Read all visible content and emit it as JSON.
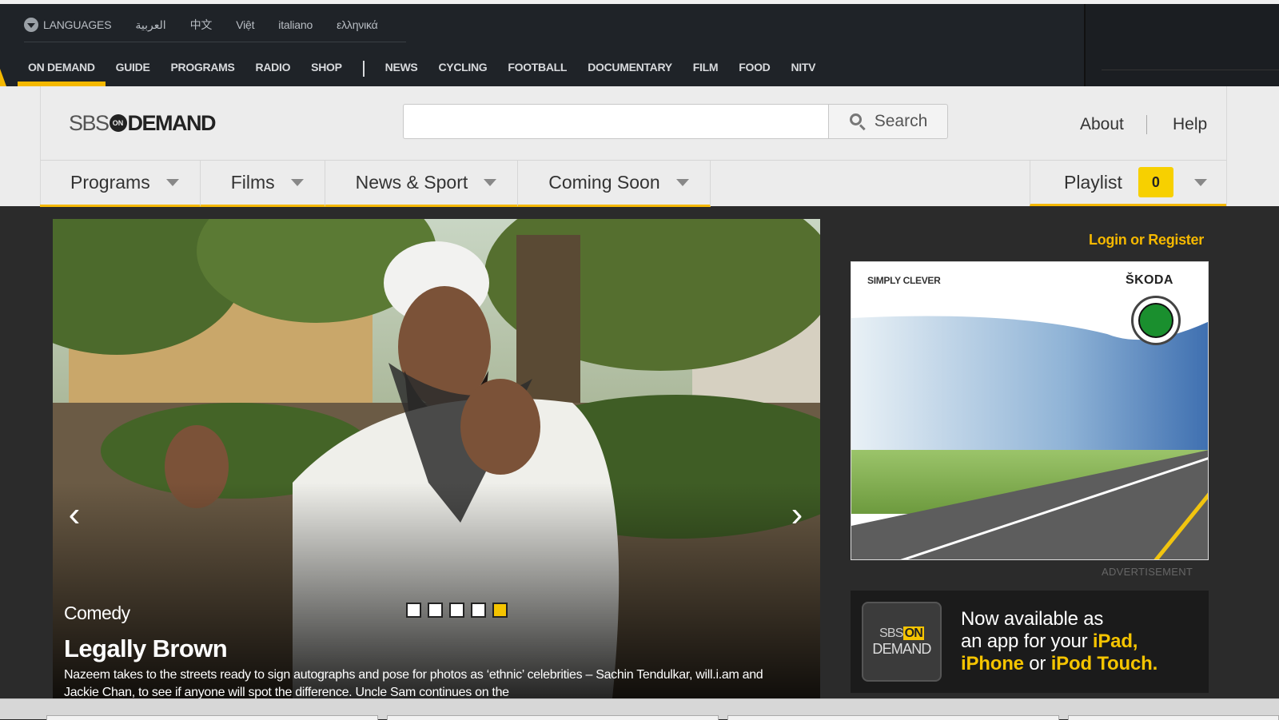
{
  "languages": {
    "label": "LANGUAGES",
    "items": [
      "العربية",
      "中文",
      "Việt",
      "italiano",
      "ελληνικά"
    ]
  },
  "main_nav": {
    "group1": [
      "ON DEMAND",
      "GUIDE",
      "PROGRAMS",
      "RADIO",
      "SHOP"
    ],
    "group2": [
      "NEWS",
      "CYCLING",
      "FOOTBALL",
      "DOCUMENTARY",
      "FILM",
      "FOOD",
      "NITV"
    ],
    "active": "ON DEMAND"
  },
  "header": {
    "logo_left": "SBS",
    "logo_on": "ON",
    "logo_right": "DEMAND",
    "search_placeholder": "",
    "search_label": "Search",
    "about": "About",
    "help": "Help"
  },
  "nav2": {
    "tabs": [
      "Programs",
      "Films",
      "News & Sport",
      "Coming Soon"
    ],
    "playlist_label": "Playlist",
    "playlist_count": "0"
  },
  "hero": {
    "genre": "Comedy",
    "title": "Legally Brown",
    "description": "Nazeem takes to the streets ready to sign autographs and pose for photos as ‘ethnic’ celebrities – Sachin Tendulkar, will.i.am and Jackie Chan, to see if anyone will spot the difference. Uncle Sam continues on the",
    "slide_count": 5,
    "active_slide": 5
  },
  "sidebar": {
    "login": "Login or Register",
    "ad": {
      "tagline": "SIMPLY CLEVER",
      "brand": "ŠKODA",
      "label": "ADVERTISEMENT"
    },
    "app_promo": {
      "icon_line1_a": "SBS",
      "icon_line1_on": "ON",
      "icon_line2": "DEMAND",
      "line1": "Now available as",
      "line2a": "an app for your ",
      "line2b": "iPad,",
      "line3a": "iPhone",
      "line3b": " or ",
      "line3c": "iPod Touch."
    }
  },
  "colors": {
    "accent": "#f5b800",
    "topbar": "#1f2328",
    "header": "#ececec"
  }
}
